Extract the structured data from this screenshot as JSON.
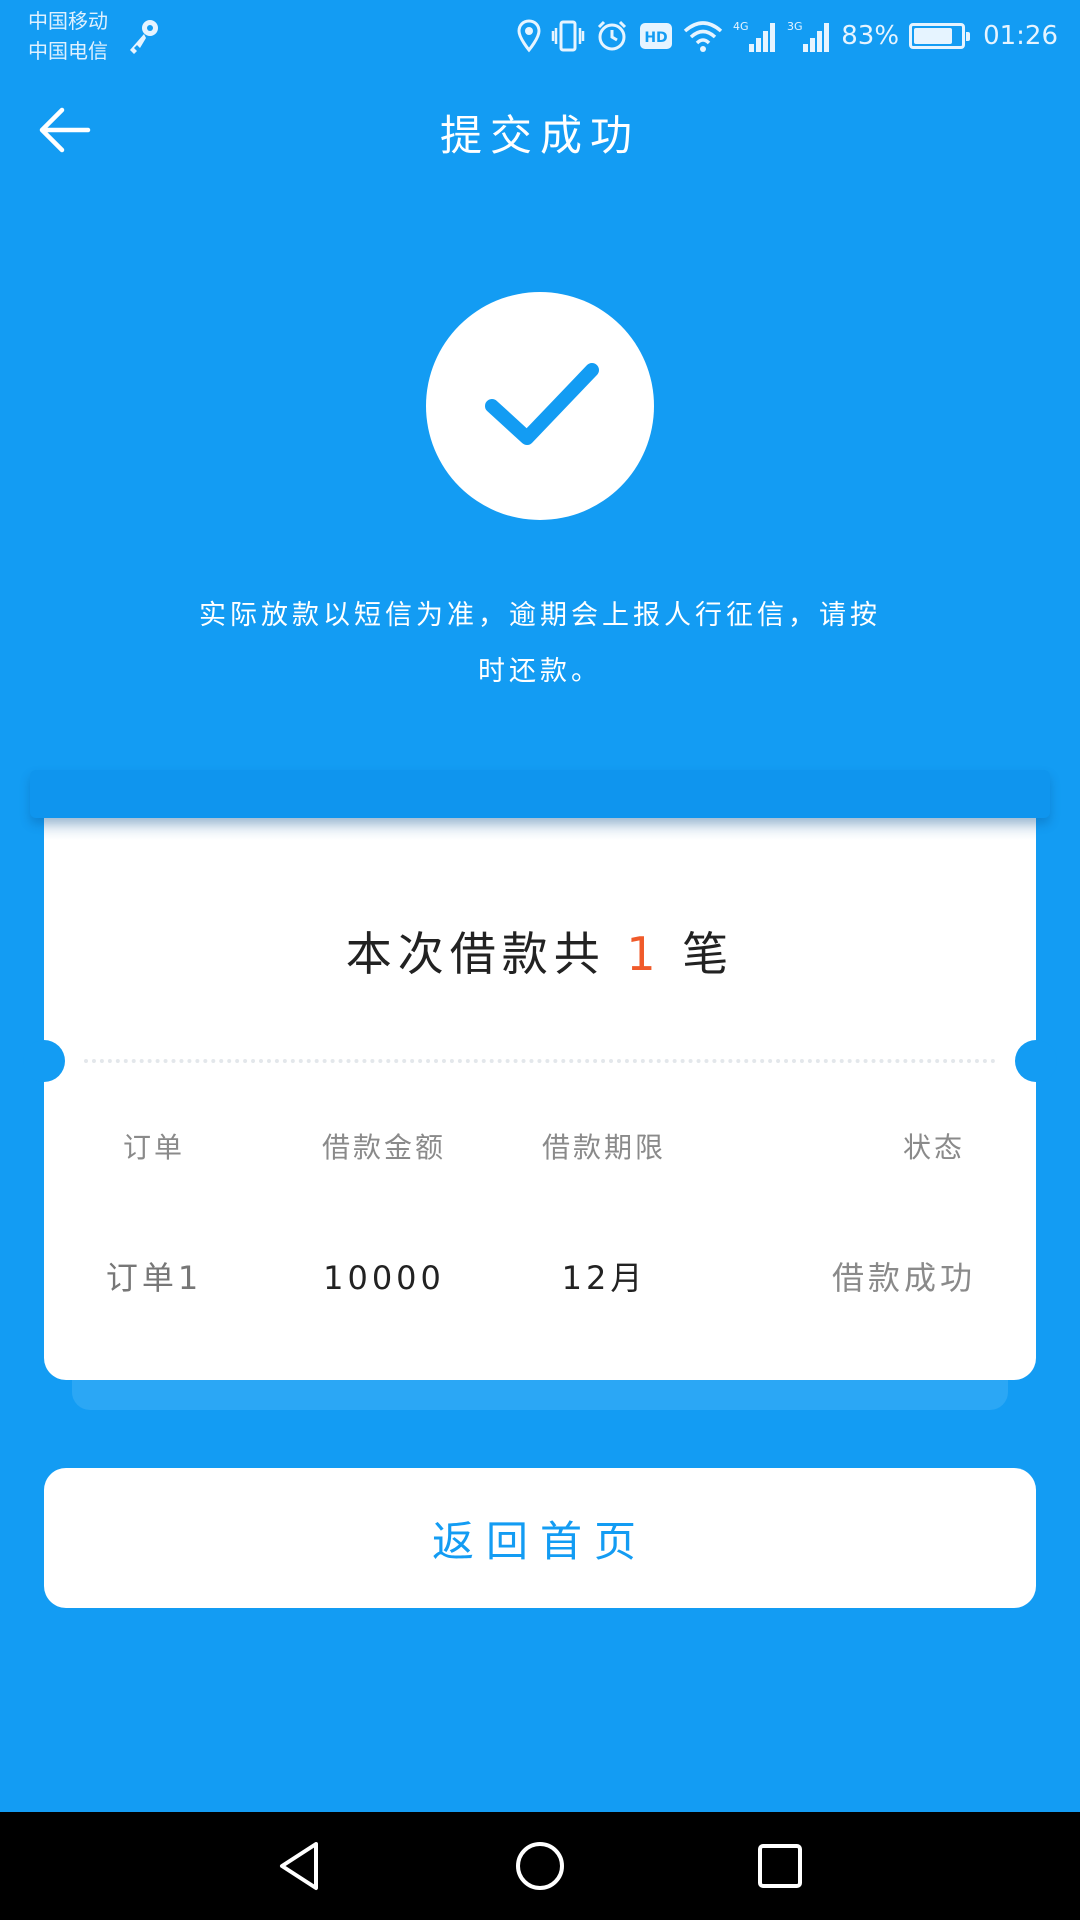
{
  "status_bar": {
    "carrier_1": "中国移动",
    "carrier_2": "中国电信",
    "network_4g": "4G",
    "network_3g": "3G",
    "hd_label": "HD",
    "battery_percent": "83%",
    "battery_level": 0.83,
    "time": "01:26",
    "icons": [
      "key-icon",
      "location-icon",
      "vibrate-icon",
      "alarm-icon",
      "hd-icon",
      "wifi-icon",
      "signal-icon",
      "battery-icon"
    ]
  },
  "header": {
    "title": "提交成功",
    "back_icon": "arrow-left-icon"
  },
  "success": {
    "icon": "check-icon",
    "notice_line_1": "实际放款以短信为准，逾期会上报人行征信，请按",
    "notice_line_2": "时还款。"
  },
  "card": {
    "count_prefix": "本次借款共",
    "count_value": "1",
    "count_suffix": "笔",
    "columns": [
      "订单",
      "借款金额",
      "借款期限",
      "状态"
    ],
    "rows": [
      [
        "订单1",
        "10000",
        "12月",
        "借款成功"
      ]
    ]
  },
  "home_button": {
    "label": "返回首页"
  },
  "colors": {
    "background": "#139CF3",
    "accent": "#139CF3",
    "count_highlight": "#F05A2A",
    "card": "#FFFFFF"
  },
  "nav_bar": {
    "icons": [
      "nav-back-icon",
      "nav-home-icon",
      "nav-recent-icon"
    ]
  }
}
